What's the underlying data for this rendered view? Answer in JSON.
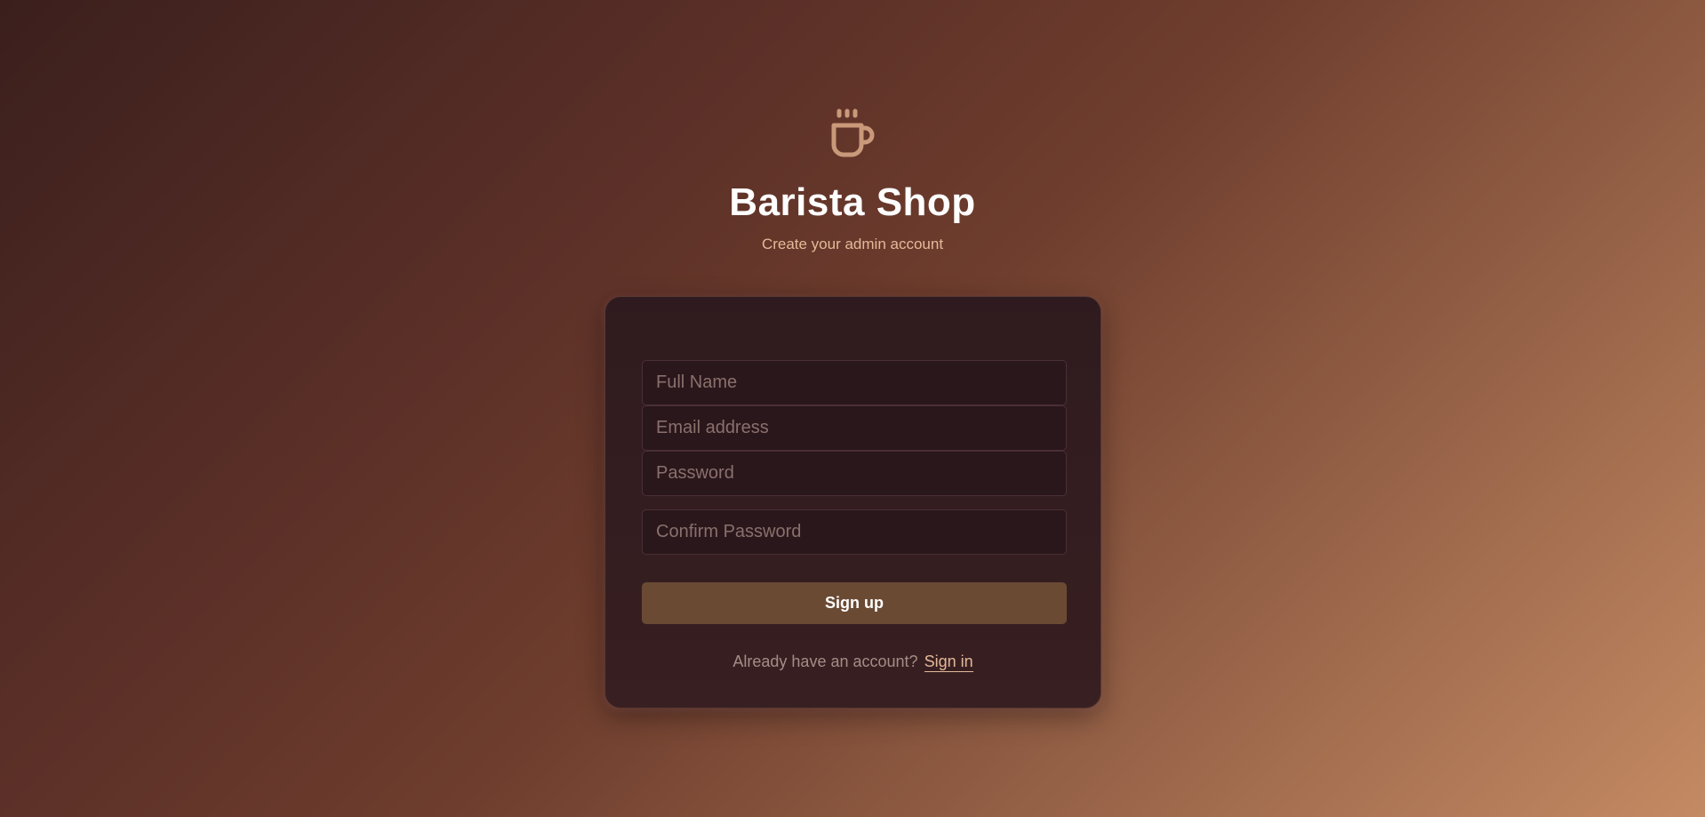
{
  "brand": {
    "icon": "coffee-cup-icon",
    "title": "Barista Shop",
    "subtitle": "Create your admin account"
  },
  "form": {
    "full_name": {
      "placeholder": "Full Name",
      "value": ""
    },
    "email": {
      "placeholder": "Email address",
      "value": ""
    },
    "password": {
      "placeholder": "Password",
      "value": ""
    },
    "confirm_password": {
      "placeholder": "Confirm Password",
      "value": ""
    },
    "submit_label": "Sign up"
  },
  "footer": {
    "prompt": "Already have an account?",
    "link_label": "Sign in"
  },
  "colors": {
    "accent": "#c9997a",
    "button": "#6b4a34",
    "link": "#e4b999",
    "card": "#2f1b1f"
  }
}
